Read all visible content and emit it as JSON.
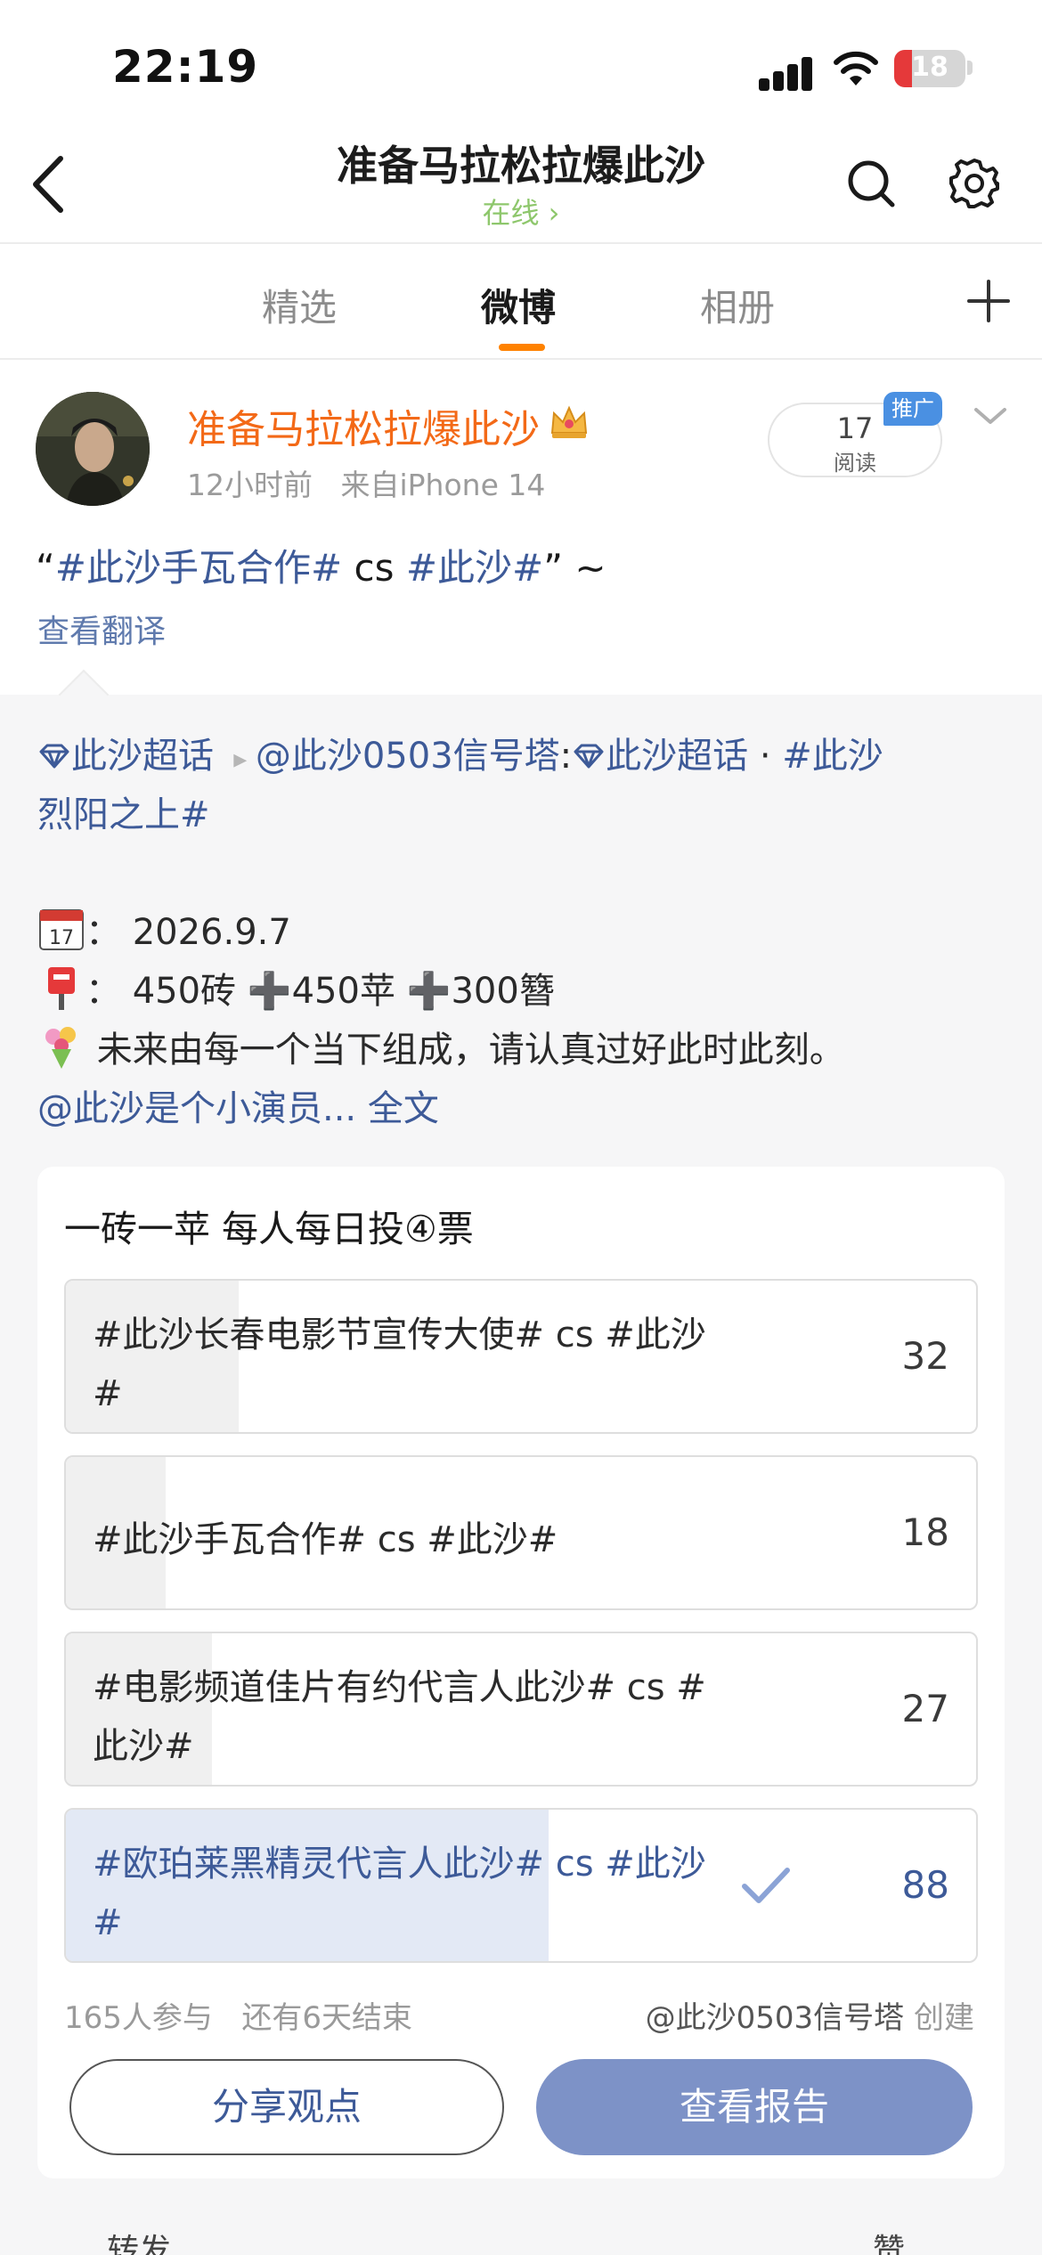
{
  "status_bar": {
    "time": "22:19",
    "battery": "18"
  },
  "header": {
    "title": "准备马拉松拉爆此沙",
    "subtitle": "在线 ›"
  },
  "tabs": [
    {
      "label": "精选"
    },
    {
      "label": "微博"
    },
    {
      "label": "相册"
    }
  ],
  "post": {
    "author": "准备马拉松拉爆此沙",
    "time": "12小时前",
    "source": "来自iPhone 14",
    "read_count": "17",
    "read_label": "阅读",
    "promo": "推广",
    "text_prefix": "“",
    "hashtag_1": "#此沙手瓦合作#",
    "text_mid": " cs ",
    "hashtag_2": "#此沙#",
    "text_suffix": "” ~",
    "translate": "查看翻译"
  },
  "repost": {
    "line1_topic": "此沙超话",
    "line1_user": "@此沙0503信号塔",
    "line1_colon": ":",
    "line1_topic2": "此沙超话",
    "line1_dot": " · ",
    "line1_hashtag_a": "#此沙",
    "line2_hashtag_b": "烈阳之上#",
    "date_label": "：  2026.9.7",
    "mail_text_1": "：  450砖",
    "mail_plus": "➕",
    "mail_text_2": "450苹",
    "mail_text_3": "300簪",
    "motto": "未来由每一个当下组成，请认真过好此时此刻。",
    "mention": "@此沙是个小演员...",
    "full_text": " 全文"
  },
  "poll": {
    "title": "一砖一苹 每人每日投④票",
    "options": [
      {
        "label": "#此沙长春电影节宣传大使# cs #此沙#",
        "count": "32",
        "fraction": 0.19
      },
      {
        "label": "#此沙手瓦合作# cs #此沙#",
        "count": "18",
        "fraction": 0.11
      },
      {
        "label": "#电影频道佳片有约代言人此沙# cs #此沙#",
        "count": "27",
        "fraction": 0.16
      },
      {
        "label": "#欧珀莱黑精灵代言人此沙# cs #此沙#",
        "count": "88",
        "fraction": 0.53,
        "selected": true
      }
    ],
    "participants": "165人参与",
    "remaining": "还有6天结束",
    "creator": "@此沙0503信号塔",
    "created": "创建",
    "share_button": "分享观点",
    "report_button": "查看报告"
  },
  "bottom_bar": {
    "repost": "转发",
    "like": "赞"
  },
  "colors": {
    "accent": "#ff8200",
    "link": "#3d5a98",
    "author": "#f36917",
    "online": "#8ec76c",
    "report_button": "#7d92c7"
  }
}
